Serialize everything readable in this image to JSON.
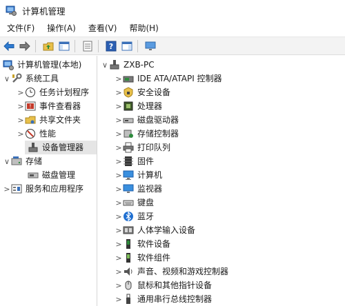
{
  "window": {
    "title": "计算机管理"
  },
  "menu": [
    "文件(F)",
    "操作(A)",
    "查看(V)",
    "帮助(H)"
  ],
  "toolbar_icons": [
    "back-arrow-icon",
    "forward-arrow-icon",
    "folder-up-icon",
    "show-hide-tree-icon",
    "properties-icon",
    "help-icon",
    "action-pane-icon",
    "monitor-icon"
  ],
  "left_tree": {
    "root": "计算机管理(本地)",
    "system_tools": "系统工具",
    "system_children": [
      "任务计划程序",
      "事件查看器",
      "共享文件夹",
      "性能",
      "设备管理器"
    ],
    "storage": "存储",
    "storage_children": [
      "磁盘管理"
    ],
    "services": "服务和应用程序"
  },
  "right_tree": {
    "computer": "ZXB-PC",
    "categories": [
      "IDE ATA/ATAPI 控制器",
      "安全设备",
      "处理器",
      "磁盘驱动器",
      "存储控制器",
      "打印队列",
      "固件",
      "计算机",
      "监视器",
      "键盘",
      "蓝牙",
      "人体学输入设备",
      "软件设备",
      "软件组件",
      "声音、视频和游戏控制器",
      "鼠标和其他指针设备",
      "通用串行总线控制器"
    ]
  }
}
